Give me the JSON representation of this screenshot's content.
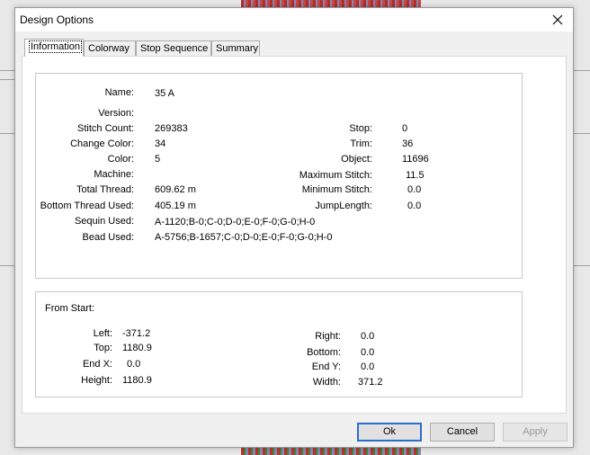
{
  "dialog": {
    "title": "Design Options",
    "tabs": [
      {
        "label": "Information"
      },
      {
        "label": "Colorway"
      },
      {
        "label": "Stop Sequence"
      },
      {
        "label": "Summary"
      }
    ],
    "info": {
      "name": {
        "label": "Name:",
        "value": "35 A"
      },
      "version": {
        "label": "Version:",
        "value": ""
      },
      "stitch_count": {
        "label": "Stitch Count:",
        "value": "269383"
      },
      "change_color": {
        "label": "Change Color:",
        "value": "34"
      },
      "color": {
        "label": "Color:",
        "value": "5"
      },
      "machine": {
        "label": "Machine:",
        "value": ""
      },
      "total_thread": {
        "label": "Total Thread:",
        "value": "609.62 m"
      },
      "bottom_thread_used": {
        "label": "Bottom Thread Used:",
        "value": "405.19 m"
      },
      "sequin_used": {
        "label": "Sequin Used:",
        "value": "A-1120;B-0;C-0;D-0;E-0;F-0;G-0;H-0"
      },
      "bead_used": {
        "label": "Bead Used:",
        "value": "A-5756;B-1657;C-0;D-0;E-0;F-0;G-0;H-0"
      },
      "stop": {
        "label": "Stop:",
        "value": "0"
      },
      "trim": {
        "label": "Trim:",
        "value": "36"
      },
      "object": {
        "label": "Object:",
        "value": "11696"
      },
      "maximum_stitch": {
        "label": "Maximum Stitch:",
        "value": "11.5"
      },
      "minimum_stitch": {
        "label": "Minimum Stitch:",
        "value": "0.0"
      },
      "jump_length": {
        "label": "JumpLength:",
        "value": "0.0"
      }
    },
    "from_start": {
      "heading": "From Start:",
      "left": {
        "label": "Left:",
        "value": "-371.2"
      },
      "top": {
        "label": "Top:",
        "value": "1180.9"
      },
      "end_x": {
        "label": "End X:",
        "value": "0.0"
      },
      "height": {
        "label": "Height:",
        "value": "1180.9"
      },
      "right": {
        "label": "Right:",
        "value": "0.0"
      },
      "bottom": {
        "label": "Bottom:",
        "value": "0.0"
      },
      "end_y": {
        "label": "End Y:",
        "value": "0.0"
      },
      "width": {
        "label": "Width:",
        "value": "371.2"
      }
    },
    "buttons": {
      "ok": "Ok",
      "cancel": "Cancel",
      "apply": "Apply"
    }
  }
}
